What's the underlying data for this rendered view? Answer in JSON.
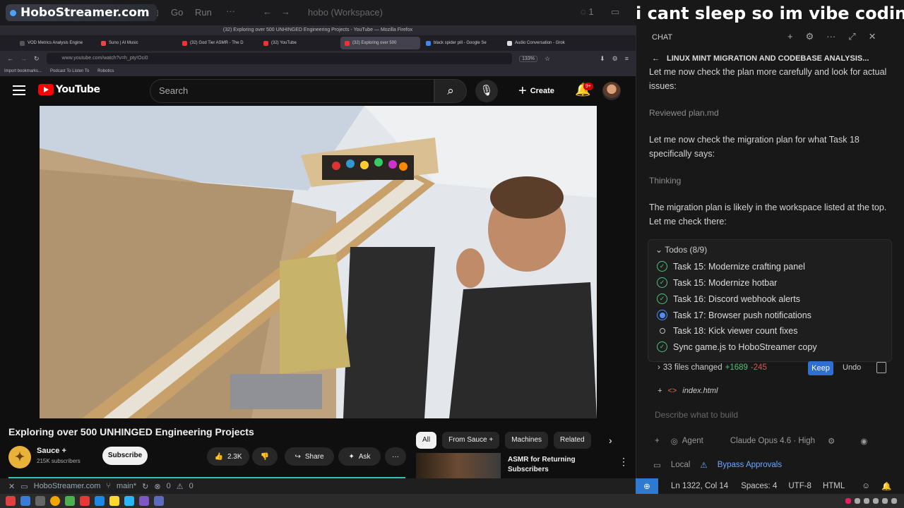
{
  "overlay": {
    "brand": "HoboStreamer.com",
    "caption": "i cant sleep so im vibe coding"
  },
  "vscode_menu": {
    "items": [
      "Go",
      "Run"
    ],
    "workspace": "hobo (Workspace)"
  },
  "browser": {
    "window_title": "(32) Exploring over 500 UNHINGED Engineering Projects - YouTube — Mozilla Firefox",
    "tabs": [
      {
        "label": "VOD Metrics Analysis Engine"
      },
      {
        "label": "Suno | AI Music"
      },
      {
        "label": "(32) God Tier ASMR - The D"
      },
      {
        "label": "(32) YouTube"
      },
      {
        "label": "(32) Exploring over 500"
      },
      {
        "label": "black spider pill - Google Se"
      },
      {
        "label": "Audio Conversation - Grok"
      }
    ],
    "url": "www.youtube.com/watch?v=h_pty!Oci0",
    "zoom": "133%",
    "bookmarks": [
      "Import bookmarks...",
      "Podcast To Listen To",
      "Robotics"
    ]
  },
  "youtube": {
    "logo": "YouTube",
    "search_placeholder": "Search",
    "create_label": "Create",
    "notifications": "9+",
    "video_title": "Exploring over 500 UNHINGED Engineering Projects",
    "channel_name": "Sauce +",
    "channel_subs": "215K subscribers",
    "subscribe_label": "Subscribe",
    "likes": "2.3K",
    "share_label": "Share",
    "ask_label": "Ask",
    "chips": [
      "All",
      "From Sauce +",
      "Machines",
      "Related"
    ],
    "recommended_title": "ASMR for Returning Subscribers"
  },
  "left_status": {
    "site": "HoboStreamer.com",
    "branch": "main*",
    "errors": "0",
    "warnings": "0"
  },
  "chat": {
    "header": "CHAT",
    "session_title": "LINUX MINT MIGRATION AND CODEBASE ANALYSIS...",
    "messages": [
      {
        "text": "Let me now check the plan more carefully and look for actual issues:",
        "dim": false
      },
      {
        "text": "Reviewed plan.md",
        "dim": true
      },
      {
        "text": "Let me now check the migration plan for what Task 18 specifically says:",
        "dim": false
      },
      {
        "text": "Thinking",
        "dim": true
      },
      {
        "text": "The migration plan is likely in the workspace listed at the top. Let me check there:",
        "dim": false
      }
    ],
    "todos_header": "Todos (8/9)",
    "todos": [
      {
        "label": "Task 15: Modernize crafting panel",
        "status": "done"
      },
      {
        "label": "Task 15: Modernize hotbar",
        "status": "done"
      },
      {
        "label": "Task 16: Discord webhook alerts",
        "status": "done"
      },
      {
        "label": "Task 17: Browser push notifications",
        "status": "in-progress"
      },
      {
        "label": "Task 18: Kick viewer count fixes",
        "status": "pending"
      },
      {
        "label": "Sync game.js to HoboStreamer copy",
        "status": "done"
      }
    ],
    "files_changed": "33 files changed",
    "additions": "+1689",
    "deletions": "-245",
    "keep_label": "Keep",
    "undo_label": "Undo",
    "file_ref": "index.html",
    "input_placeholder": "Describe what to build",
    "mode": "Agent",
    "model": "Claude Opus 4.6 · High",
    "location": "Local",
    "approvals": "Bypass Approvals"
  },
  "statusbar": {
    "position": "Ln 1322, Col 14",
    "spaces": "Spaces: 4",
    "encoding": "UTF-8",
    "language": "HTML"
  }
}
